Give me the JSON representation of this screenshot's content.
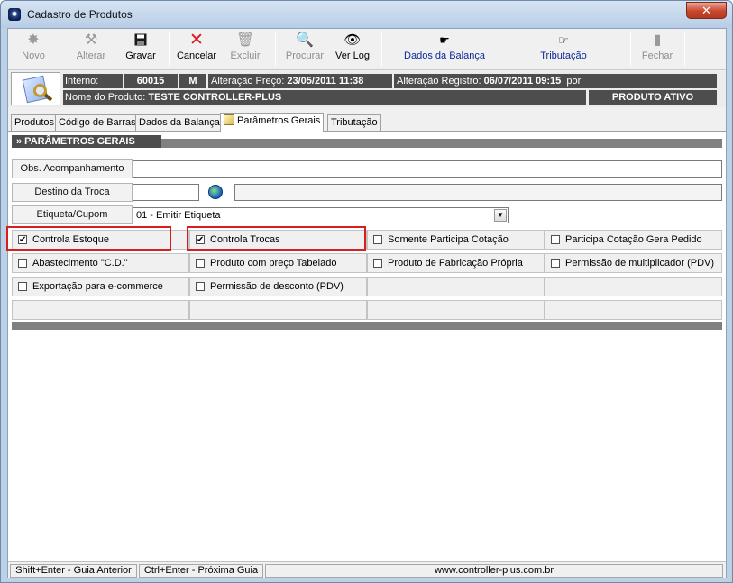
{
  "window": {
    "title": "Cadastro de Produtos",
    "close_label": "✕"
  },
  "toolbar": {
    "novo": "Novo",
    "alterar": "Alterar",
    "gravar": "Gravar",
    "cancelar": "Cancelar",
    "excluir": "Excluir",
    "procurar": "Procurar",
    "ver_log": "Ver Log",
    "dados_balanca": "Dados da Balança",
    "tributacao": "Tributação",
    "fechar": "Fechar"
  },
  "info": {
    "interno_label": "Interno:",
    "interno_value": "60015",
    "flag": "M",
    "alt_preco_label": "Alteração Preço:",
    "alt_preco_value": "23/05/2011 11:38",
    "alt_registro_label": "Alteração Registro:",
    "alt_registro_value": "06/07/2011  09:15",
    "por_label": "por",
    "nome_label": "Nome do Produto:",
    "nome_value": "TESTE CONTROLLER-PLUS",
    "status": "PRODUTO ATIVO"
  },
  "tabs": [
    "Produtos",
    "Código de Barras",
    "Dados da Balança",
    "Parâmetros Gerais",
    "Tributação"
  ],
  "section": {
    "title": "» PARÂMETROS GERAIS"
  },
  "fields": {
    "obs_label": "Obs. Acompanhamento",
    "obs_value": "",
    "destino_label": "Destino da Troca",
    "destino_value": "",
    "destino_desc": "",
    "etiqueta_label": "Etiqueta/Cupom",
    "etiqueta_value": "01 - Emitir Etiqueta"
  },
  "checkboxes": [
    {
      "label": "Controla Estoque",
      "checked": true
    },
    {
      "label": "Controla Trocas",
      "checked": true
    },
    {
      "label": "Somente Participa Cotação",
      "checked": false
    },
    {
      "label": "Participa Cotação Gera Pedido",
      "checked": false
    },
    {
      "label": "Abastecimento \"C.D.\"",
      "checked": false
    },
    {
      "label": "Produto com preço Tabelado",
      "checked": false
    },
    {
      "label": "Produto de Fabricação Própria",
      "checked": false
    },
    {
      "label": "Permissão de multiplicador (PDV)",
      "checked": false
    },
    {
      "label": "Exportação para e-commerce",
      "checked": false
    },
    {
      "label": "Permissão de desconto (PDV)",
      "checked": false
    }
  ],
  "status": {
    "prev": "Shift+Enter - Guia Anterior",
    "next": "Ctrl+Enter - Próxima Guia",
    "site": "www.controller-plus.com.br"
  },
  "colors": {
    "highlight": "#d81e1e",
    "dark_bar": "#4d4d4d",
    "tab_link": "#0a2a9a"
  }
}
